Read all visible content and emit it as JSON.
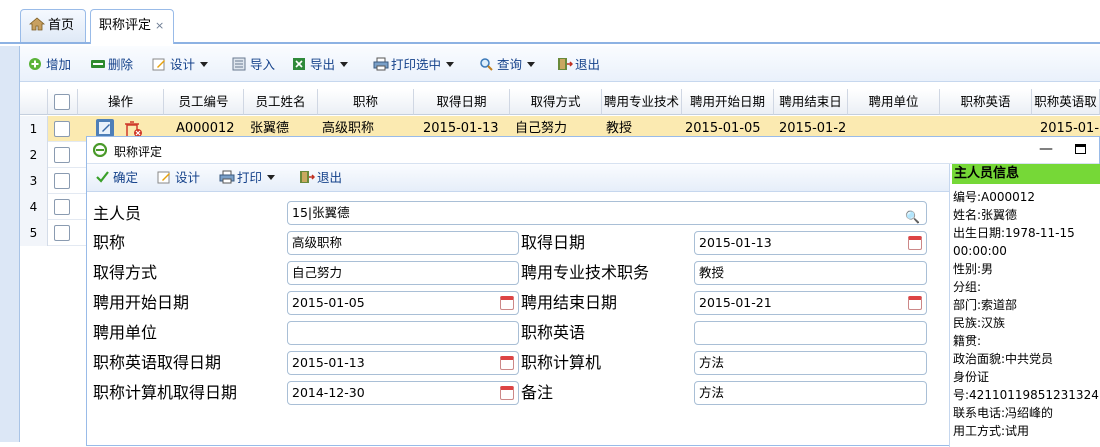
{
  "tabs": [
    {
      "label": "首页",
      "icon": "home-icon"
    },
    {
      "label": "职称评定",
      "close": "×"
    }
  ],
  "toolbar": {
    "add": "增加",
    "delete": "删除",
    "design": "设计",
    "import": "导入",
    "export": "导出",
    "print_selected": "打印选中",
    "query": "查询",
    "exit": "退出"
  },
  "grid": {
    "headers": [
      "操作",
      "员工编号",
      "员工姓名",
      "职称",
      "取得日期",
      "取得方式",
      "聘用专业技术",
      "聘用开始日期",
      "聘用结束日",
      "聘用单位",
      "职称英语",
      "职称英语取"
    ],
    "row1": {
      "num": "1",
      "emp_no": "A000012",
      "emp_name": "张翼德",
      "title": "高级职称",
      "get_date": "2015-01-13",
      "get_way": "自己努力",
      "prof": "教授",
      "start": "2015-01-05",
      "end": "2015-01-2",
      "unit": "",
      "eng": "",
      "eng_date": "2015-01-"
    },
    "row_nums": [
      "2",
      "3",
      "4",
      "5"
    ]
  },
  "dialog": {
    "title": "职称评定",
    "toolbar": {
      "confirm": "确定",
      "design": "设计",
      "print": "打印",
      "exit": "退出"
    },
    "fields": {
      "master_label": "主人员",
      "master_value": "15|张翼德",
      "title_label": "职称",
      "title_value": "高级职称",
      "get_date_label": "取得日期",
      "get_date_value": "2015-01-13",
      "get_way_label": "取得方式",
      "get_way_value": "自己努力",
      "prof_label": "聘用专业技术职务",
      "prof_value": "教授",
      "start_label": "聘用开始日期",
      "start_value": "2015-01-05",
      "end_label": "聘用结束日期",
      "end_value": "2015-01-21",
      "unit_label": "聘用单位",
      "unit_value": "",
      "eng_label": "职称英语",
      "eng_value": "",
      "eng_date_label": "职称英语取得日期",
      "eng_date_value": "2015-01-13",
      "comp_label": "职称计算机",
      "comp_value": "方法",
      "comp_date_label": "职称计算机取得日期",
      "comp_date_value": "2014-12-30",
      "remark_label": "备注",
      "remark_value": "方法"
    }
  },
  "side_panel": {
    "title": "主人员信息",
    "lines": [
      "编号:A000012",
      "姓名:张翼德",
      "出生日期:1978-11-15",
      "00:00:00",
      "性别:男",
      "分组:",
      "部门:索道部",
      "民族:汉族",
      "籍贯:",
      "政治面貌:中共党员",
      "身份证",
      "号:42110119851231324",
      "联系电话:冯绍峰的",
      "用工方式:试用"
    ]
  },
  "colors": {
    "accent": "#15428b",
    "selected_row": "#fbeab1",
    "side_head": "#76d837"
  }
}
